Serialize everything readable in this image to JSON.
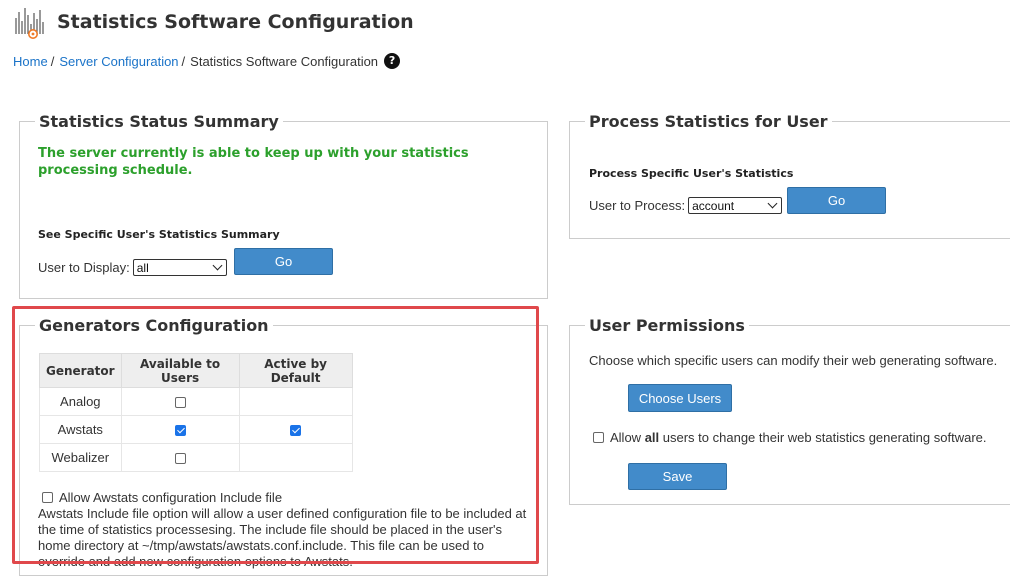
{
  "header": {
    "title": "Statistics Software Configuration",
    "logo_icon": "stats-chart-gear-icon"
  },
  "breadcrumb": {
    "items": [
      "Home",
      "Server Configuration"
    ],
    "current": "Statistics Software Configuration",
    "separator": "/",
    "help_icon": "question-circle-icon"
  },
  "status_summary": {
    "legend": "Statistics Status Summary",
    "message": "The server currently is able to keep up with your statistics processing schedule.",
    "sub_heading": "See Specific User's Statistics Summary",
    "field_label": "User to Display:",
    "select_value": "all",
    "go_label": "Go"
  },
  "process_stats": {
    "legend": "Process Statistics for User",
    "sub_heading": "Process Specific User's Statistics",
    "field_label": "User to Process:",
    "select_value": "account",
    "go_label": "Go"
  },
  "generators": {
    "legend": "Generators Configuration",
    "columns": [
      "Generator",
      "Available to Users",
      "Active by Default"
    ],
    "rows": [
      {
        "name": "Analog",
        "available": false,
        "active": null
      },
      {
        "name": "Awstats",
        "available": true,
        "active": true
      },
      {
        "name": "Webalizer",
        "available": false,
        "active": null
      }
    ],
    "include_label": "Allow Awstats configuration Include file",
    "include_checked": false,
    "include_description": "Awstats Include file option will allow a user defined configuration file to be included at the time of statistics processesing. The include file should be placed in the user's home directory at ~/tmp/awstats/awstats.conf.include. This file can be used to override and add new configuration options to Awstats."
  },
  "permissions": {
    "legend": "User Permissions",
    "description": "Choose which specific users can modify their web generating software.",
    "choose_label": "Choose Users",
    "allow_prefix": "Allow ",
    "allow_bold": "all",
    "allow_suffix": " users to change their web statistics generating software.",
    "allow_checked": false,
    "save_label": "Save"
  },
  "colors": {
    "link": "#1a73c8",
    "success_text": "#2ca02c",
    "button": "#428bca",
    "highlight": "#e0484b",
    "checkbox_checked": "#1a73e8"
  }
}
